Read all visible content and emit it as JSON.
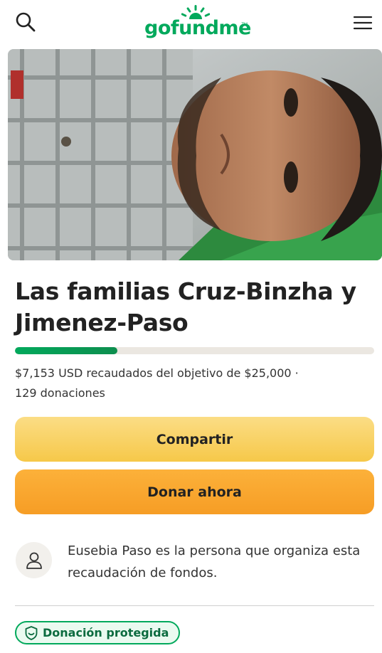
{
  "header": {
    "logo_text": "gofundme",
    "logo_tm": "TM"
  },
  "campaign": {
    "title": "Las familias Cruz-Binzha y Jimenez-Paso",
    "progress_fraction": 0.286,
    "raised_line1": "$7,153 USD recaudados del objetivo de $25,000  ·",
    "raised_line2": "129 donaciones",
    "photo_label": "campaign-photo"
  },
  "actions": {
    "share_label": "Compartir",
    "donate_label": "Donar ahora"
  },
  "organizer": {
    "text_line1": "Eusebia Paso es la persona que organiza esta",
    "text_line2": "recaudación de fondos."
  },
  "protection": {
    "badge_label": "Donación protegida"
  },
  "colors": {
    "brand_green": "#02a95c",
    "share_yellow": "#f6c849",
    "donate_orange": "#f69d25"
  }
}
